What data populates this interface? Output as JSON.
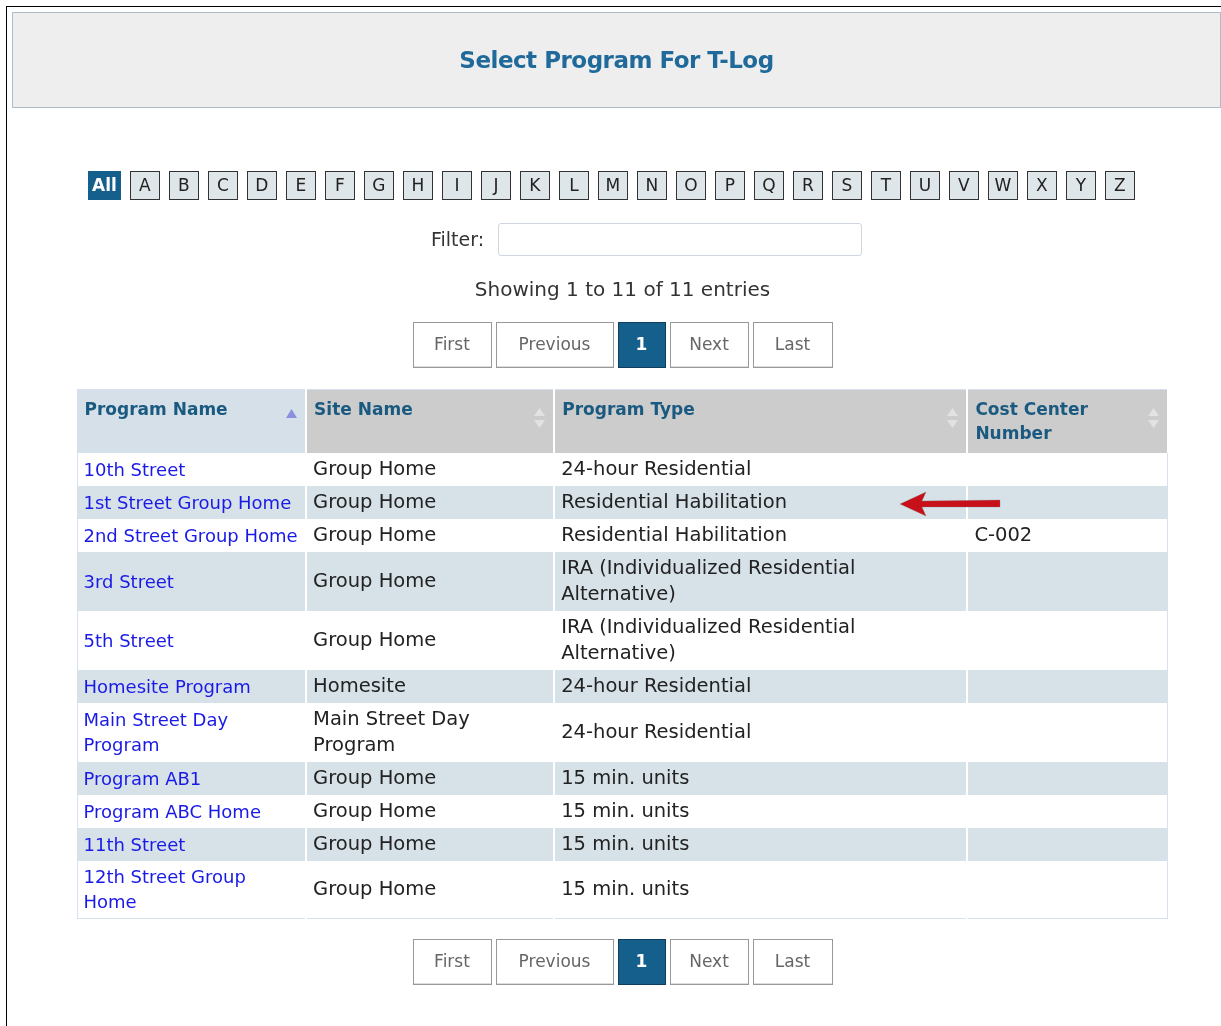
{
  "title": "Select Program For T-Log",
  "letters": [
    {
      "label": "All",
      "selected": true
    },
    {
      "label": "A",
      "selected": false
    },
    {
      "label": "B",
      "selected": false
    },
    {
      "label": "C",
      "selected": false
    },
    {
      "label": "D",
      "selected": false
    },
    {
      "label": "E",
      "selected": false
    },
    {
      "label": "F",
      "selected": false
    },
    {
      "label": "G",
      "selected": false
    },
    {
      "label": "H",
      "selected": false
    },
    {
      "label": "I",
      "selected": false
    },
    {
      "label": "J",
      "selected": false
    },
    {
      "label": "K",
      "selected": false
    },
    {
      "label": "L",
      "selected": false
    },
    {
      "label": "M",
      "selected": false
    },
    {
      "label": "N",
      "selected": false
    },
    {
      "label": "O",
      "selected": false
    },
    {
      "label": "P",
      "selected": false
    },
    {
      "label": "Q",
      "selected": false
    },
    {
      "label": "R",
      "selected": false
    },
    {
      "label": "S",
      "selected": false
    },
    {
      "label": "T",
      "selected": false
    },
    {
      "label": "U",
      "selected": false
    },
    {
      "label": "V",
      "selected": false
    },
    {
      "label": "W",
      "selected": false
    },
    {
      "label": "X",
      "selected": false
    },
    {
      "label": "Y",
      "selected": false
    },
    {
      "label": "Z",
      "selected": false
    }
  ],
  "filter": {
    "label": "Filter:"
  },
  "info": "Showing 1 to 11 of 11 entries",
  "pager_top": [
    {
      "label": "First",
      "selected": false
    },
    {
      "label": "Previous",
      "selected": false
    },
    {
      "label": "1",
      "selected": true
    },
    {
      "label": "Next",
      "selected": false
    },
    {
      "label": "Last",
      "selected": false
    }
  ],
  "table": {
    "columns": [
      {
        "label": "Program Name",
        "sorted": true
      },
      {
        "label": "Site Name",
        "sorted": false
      },
      {
        "label": "Program Type",
        "sorted": false
      },
      {
        "label": "Cost Center Number",
        "sorted": false
      }
    ],
    "rows": [
      {
        "cells": [
          "10th Street",
          "Group Home",
          "24-hour Residential",
          ""
        ],
        "arrow": false
      },
      {
        "cells": [
          "1st Street Group Home",
          "Group Home",
          "Residential Habilitation",
          ""
        ],
        "arrow": true
      },
      {
        "cells": [
          "2nd Street Group Home",
          "Group Home",
          "Residential Habilitation",
          "C-002"
        ],
        "arrow": false
      },
      {
        "cells": [
          "3rd Street",
          "Group Home",
          "IRA (Individualized Residential Alternative)",
          ""
        ],
        "arrow": false
      },
      {
        "cells": [
          "5th Street",
          "Group Home",
          "IRA (Individualized Residential Alternative)",
          ""
        ],
        "arrow": false
      },
      {
        "cells": [
          "Homesite Program",
          "Homesite",
          "24-hour Residential",
          ""
        ],
        "arrow": false
      },
      {
        "cells": [
          "Main Street Day Program",
          "Main Street Day Program",
          "24-hour Residential",
          ""
        ],
        "arrow": false
      },
      {
        "cells": [
          "Program AB1",
          "Group Home",
          "15 min. units",
          ""
        ],
        "arrow": false
      },
      {
        "cells": [
          "Program ABC Home",
          "Group Home",
          "15 min. units",
          ""
        ],
        "arrow": false
      },
      {
        "cells": [
          "11th Street",
          "Group Home",
          "15 min. units",
          ""
        ],
        "arrow": false
      },
      {
        "cells": [
          "12th Street Group Home",
          "Group Home",
          "15 min. units",
          ""
        ],
        "arrow": false
      }
    ]
  },
  "pager_bottom": [
    {
      "label": "First",
      "selected": false
    },
    {
      "label": "Previous",
      "selected": false
    },
    {
      "label": "1",
      "selected": true
    },
    {
      "label": "Next",
      "selected": false
    },
    {
      "label": "Last",
      "selected": false
    }
  ]
}
